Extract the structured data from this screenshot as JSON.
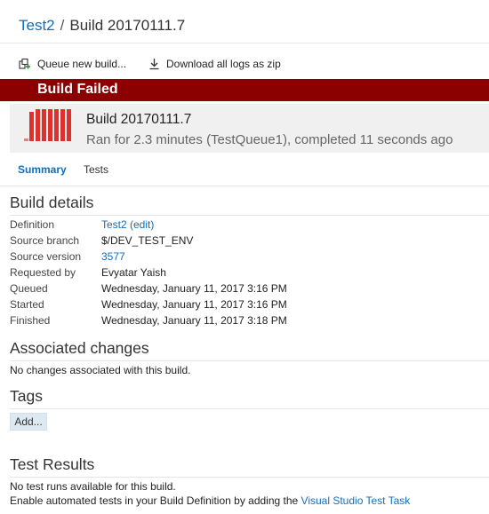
{
  "breadcrumb": {
    "parent": "Test2",
    "separator": "/",
    "current": "Build 20170111.7"
  },
  "toolbar": {
    "queue_label": "Queue new build...",
    "download_label": "Download all logs as zip"
  },
  "banner": {
    "text": "Build Failed",
    "color": "#8b0000"
  },
  "build": {
    "title": "Build 20170111.7",
    "subtitle": "Ran for 2.3 minutes (TestQueue1), completed 11 seconds ago",
    "status_color": "#e0302c"
  },
  "tabs": [
    {
      "label": "Summary",
      "active": true
    },
    {
      "label": "Tests",
      "active": false
    }
  ],
  "build_details": {
    "title": "Build details",
    "rows": [
      {
        "label": "Definition",
        "value": "Test2 (edit)"
      },
      {
        "label": "Source branch",
        "value": "$/DEV_TEST_ENV"
      },
      {
        "label": "Source version",
        "value": "3577"
      },
      {
        "label": "Requested by",
        "value": "Evyatar Yaish"
      },
      {
        "label": "Queued",
        "value": "Wednesday, January 11, 2017 3:16 PM"
      },
      {
        "label": "Started",
        "value": "Wednesday, January 11, 2017 3:16 PM"
      },
      {
        "label": "Finished",
        "value": "Wednesday, January 11, 2017 3:18 PM"
      }
    ]
  },
  "associated_changes": {
    "title": "Associated changes",
    "text": "No changes associated with this build."
  },
  "tags": {
    "title": "Tags",
    "add_label": "Add..."
  },
  "test_results": {
    "title": "Test Results",
    "line1": "No test runs available for this build.",
    "line2_prefix": "Enable automated tests in your Build Definition by adding the ",
    "line2_link": "Visual Studio Test Task"
  }
}
